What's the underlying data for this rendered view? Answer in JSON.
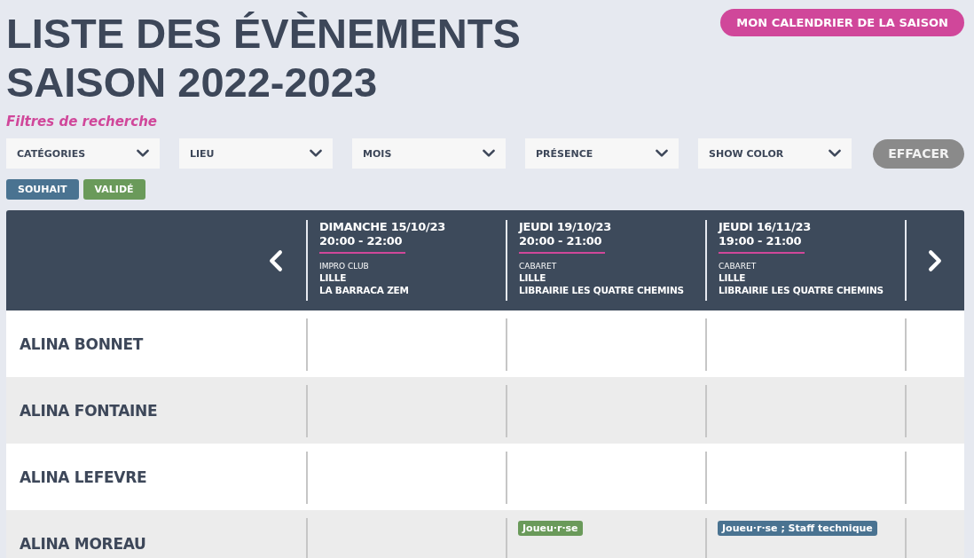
{
  "header": {
    "title_lines": [
      "LISTE DES ÉVÈNEMENTS",
      "SAISON 2022-2023"
    ],
    "calendar_button": "MON CALENDRIER DE LA SAISON"
  },
  "filters": {
    "heading": "Filtres de recherche",
    "dropdowns": [
      "CATÉGORIES",
      "LIEU",
      "MOIS",
      "PRÉSENCE",
      "SHOW COLOR"
    ],
    "clear_button": "EFFACER"
  },
  "legend": [
    {
      "label": "SOUHAIT",
      "color": "#4a7391"
    },
    {
      "label": "VALIDÉ",
      "color": "#6a9a5a"
    }
  ],
  "events": [
    {
      "date": "DIMANCHE 15/10/23",
      "time": "20:00 - 22:00",
      "category": "IMPRO CLUB",
      "city": "LILLE",
      "venue": "LA BARRACA ZEM"
    },
    {
      "date": "JEUDI 19/10/23",
      "time": "20:00 - 21:00",
      "category": "CABARET",
      "city": "LILLE",
      "venue": "LIBRAIRIE LES QUATRE CHEMINS"
    },
    {
      "date": "JEUDI 16/11/23",
      "time": "19:00 - 21:00",
      "category": "CABARET",
      "city": "LILLE",
      "venue": "LIBRAIRIE LES QUATRE CHEMINS"
    }
  ],
  "people": [
    {
      "name": "ALINA BONNET"
    },
    {
      "name": "ALINA FONTAINE"
    },
    {
      "name": "ALINA LEFEVRE"
    },
    {
      "name": "ALINA MOREAU",
      "cells": [
        {},
        {
          "tag": {
            "label": "Joueu·r·se",
            "color": "#6a9a5a"
          }
        },
        {
          "tag": {
            "label": "Joueu·r·se ; Staff technique",
            "color": "#4a7391"
          }
        }
      ]
    }
  ]
}
